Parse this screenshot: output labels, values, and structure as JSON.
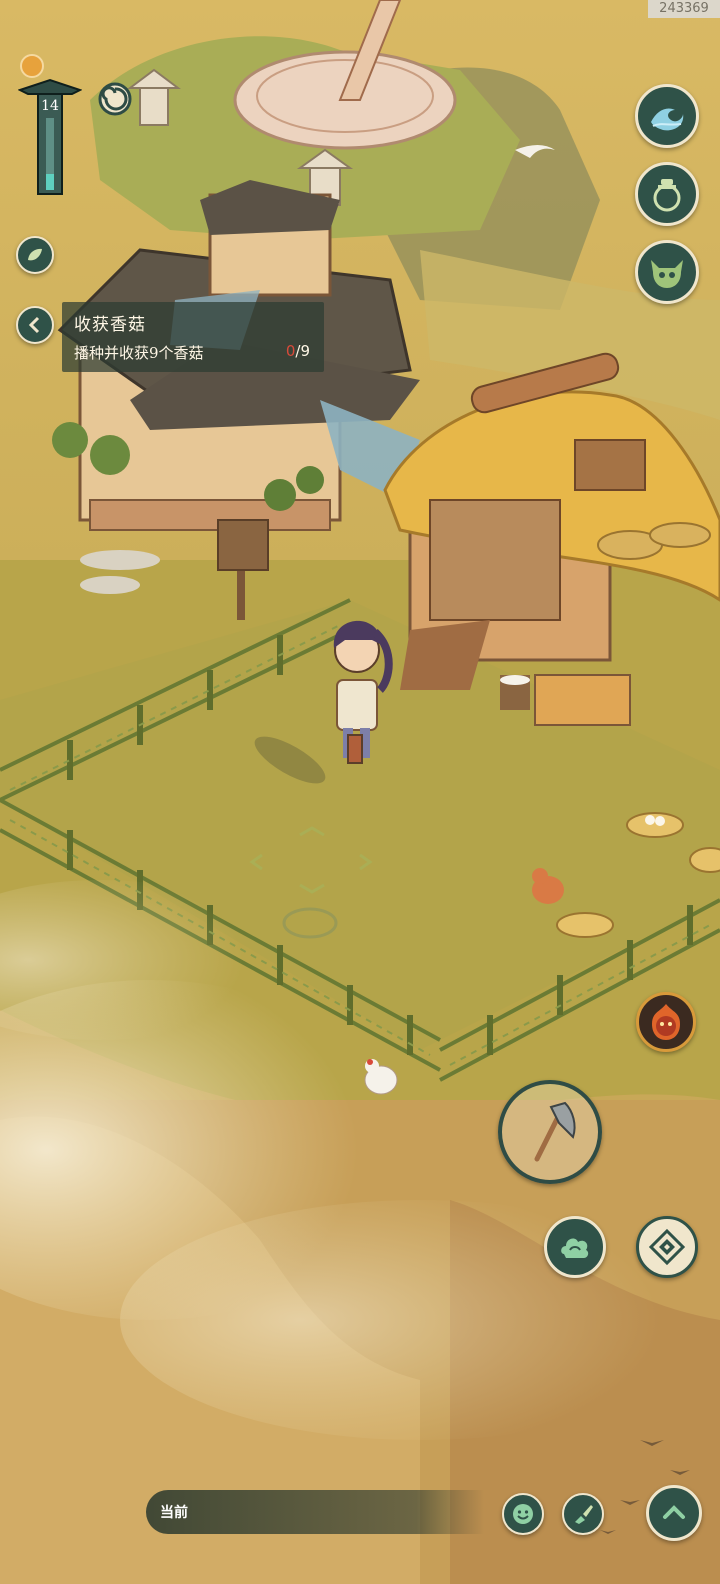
{
  "watermark": "243369",
  "hud": {
    "level": "14"
  },
  "quest": {
    "title": "收获香菇",
    "description": "播种并收获9个香菇",
    "progress_current": "0",
    "progress_total": "/9"
  },
  "chat": {
    "channel_label": "当前"
  },
  "icons": {
    "wave": "wave-icon",
    "jar": "jar-icon",
    "demon": "horned-mask-icon",
    "fire_face": "fire-spirit-icon",
    "axe": "axe-icon",
    "cloud": "cloud-icon",
    "compass": "diamond-compass-icon",
    "smile": "smile-icon",
    "brush": "brush-icon",
    "up": "chevron-up-icon"
  },
  "colors": {
    "accent_button": "#2f5248",
    "ground": "#b9a64a",
    "quest_progress": "#d84a3a"
  }
}
